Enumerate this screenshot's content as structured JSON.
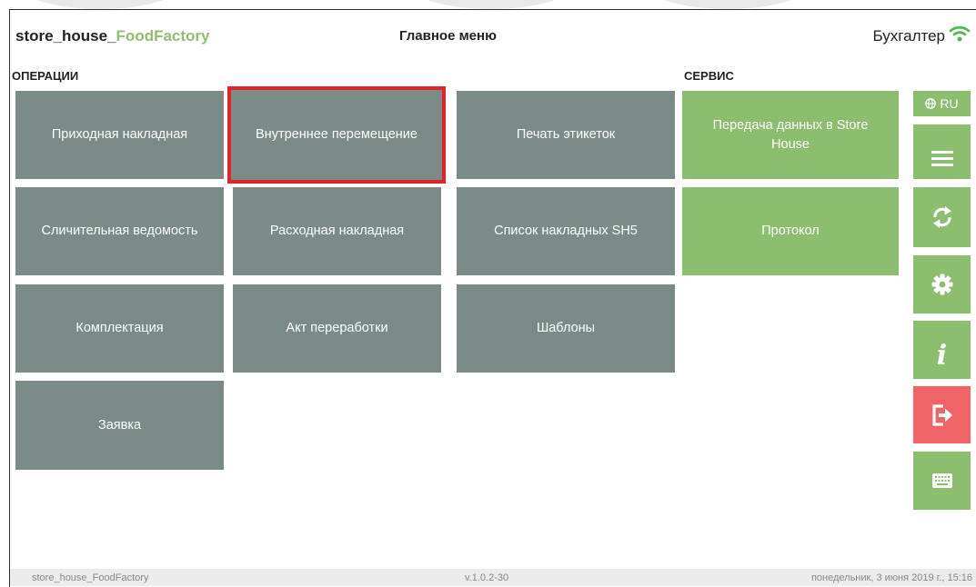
{
  "header": {
    "app_name_primary": "store_house_",
    "app_name_accent": "FoodFactory",
    "menu_title": "Главное меню",
    "user_role": "Бухгалтер"
  },
  "sections": {
    "operations_label": "ОПЕРАЦИИ",
    "service_label": "СЕРВИС"
  },
  "operations": [
    {
      "label": "Приходная накладная"
    },
    {
      "label": "Внутреннее перемещение",
      "selected": true
    },
    {
      "label": "Печать этикеток"
    },
    {
      "label": "Сличительная ведомость"
    },
    {
      "label": "Расходная накладная"
    },
    {
      "label": "Список накладных SH5"
    },
    {
      "label": "Комплектация"
    },
    {
      "label": "Акт переработки"
    },
    {
      "label": "Шаблоны"
    },
    {
      "label": "Заявка"
    }
  ],
  "service": [
    {
      "label": "Передача данных в Store House"
    },
    {
      "label": "Протокол"
    }
  ],
  "sidebar": {
    "language": "RU",
    "buttons": [
      "globe-icon",
      "hamburger-menu-icon",
      "sync-icon",
      "gear-icon",
      "info-icon",
      "logout-icon",
      "keyboard-icon"
    ]
  },
  "colors": {
    "tile_gray": "#7b8c88",
    "accent_green": "#8cbe6f",
    "logout_red": "#f06467",
    "selection_red": "#e3232b"
  },
  "footer": {
    "left": "store_house_FoodFactory",
    "version": "v.1.0.2-30",
    "datetime": "понедельник, 3 июня 2019 г., 15:16"
  }
}
